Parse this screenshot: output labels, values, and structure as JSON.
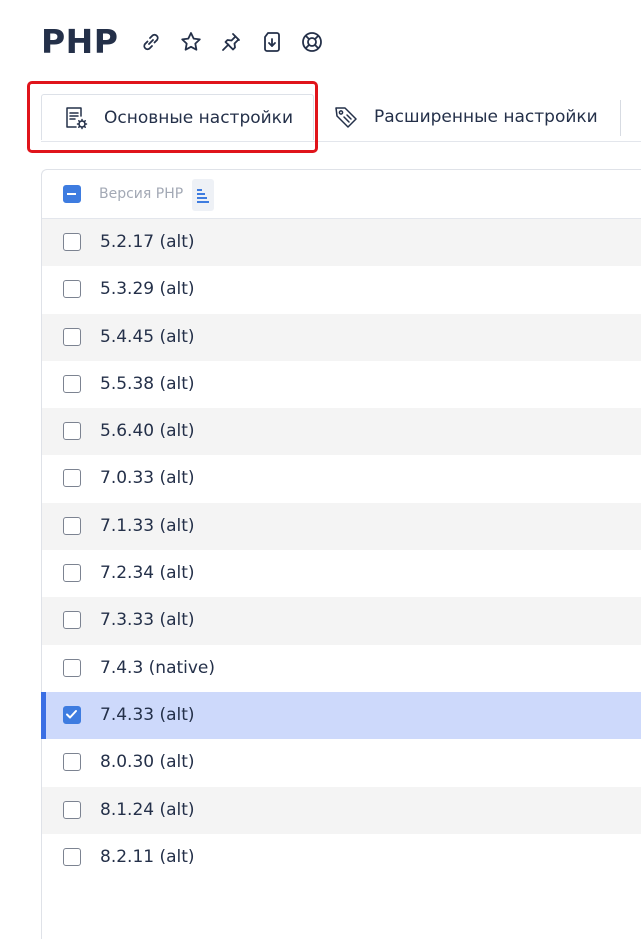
{
  "header": {
    "title": "PHP",
    "icons": [
      "link-icon",
      "star-icon",
      "pin-icon",
      "download-doc-icon",
      "help-lifebuoy-icon"
    ]
  },
  "toolbar": {
    "basic_settings_label": "Основные настройки",
    "advanced_settings_label": "Расширенные настройки",
    "active_tab": "basic_settings"
  },
  "table": {
    "column_header": "Версия PHP",
    "rows": [
      {
        "version": "5.2.17 (alt)",
        "checked": false
      },
      {
        "version": "5.3.29 (alt)",
        "checked": false
      },
      {
        "version": "5.4.45 (alt)",
        "checked": false
      },
      {
        "version": "5.5.38 (alt)",
        "checked": false
      },
      {
        "version": "5.6.40 (alt)",
        "checked": false
      },
      {
        "version": "7.0.33 (alt)",
        "checked": false
      },
      {
        "version": "7.1.33 (alt)",
        "checked": false
      },
      {
        "version": "7.2.34 (alt)",
        "checked": false
      },
      {
        "version": "7.3.33 (alt)",
        "checked": false
      },
      {
        "version": "7.4.3 (native)",
        "checked": false
      },
      {
        "version": "7.4.33 (alt)",
        "checked": true
      },
      {
        "version": "8.0.30 (alt)",
        "checked": false
      },
      {
        "version": "8.1.24 (alt)",
        "checked": false
      },
      {
        "version": "8.2.11 (alt)",
        "checked": false
      }
    ]
  },
  "colors": {
    "accent": "#3e7ce0",
    "selected_row": "#cdd9fb",
    "highlight_frame": "#e0141b",
    "text": "#243049"
  }
}
